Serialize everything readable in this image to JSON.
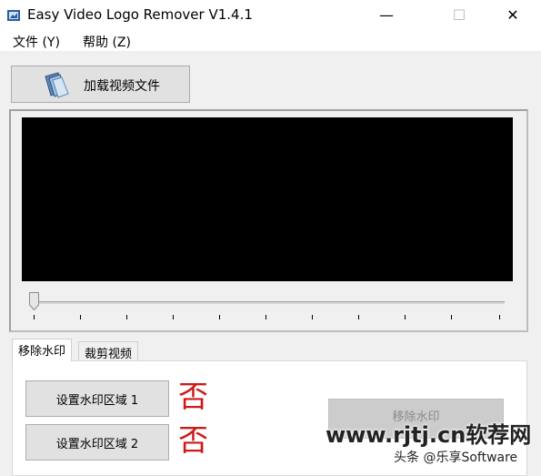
{
  "window": {
    "title": "Easy Video Logo Remover V1.4.1",
    "minimize_glyph": "—",
    "maximize_glyph": "☐",
    "close_glyph": "✕"
  },
  "menu": {
    "file": "文件 (Y)",
    "help": "帮助 (Z)"
  },
  "toolbar": {
    "load_label": "加载视频文件"
  },
  "tabs": [
    {
      "label": "移除水印",
      "active": true
    },
    {
      "label": "裁剪视频",
      "active": false
    }
  ],
  "regions": [
    {
      "button_label": "设置水印区域 1",
      "status": "否"
    },
    {
      "button_label": "设置水印区域 2",
      "status": "否"
    }
  ],
  "remove_button_label": "移除水印",
  "watermark": {
    "site": "www.rjtj.cn软荐网",
    "author": "头条 @乐享Software"
  },
  "colors": {
    "status_red": "#cc1a1a",
    "video_bg": "#000000",
    "window_bg": "#f0f0f0"
  },
  "icons": {
    "app": "app-logo-icon",
    "load": "folder-open-icon",
    "slider_thumb": "slider-thumb-icon"
  }
}
